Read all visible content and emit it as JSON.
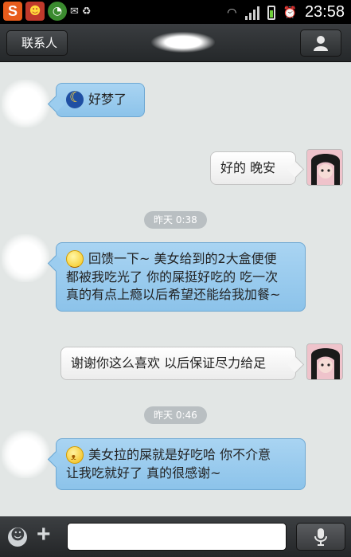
{
  "status_bar": {
    "time": "23:58",
    "app_icons": [
      "weibo-s-icon",
      "face-app-icon",
      "browser-icon",
      "mail-icon",
      "recycle-icon"
    ],
    "s_letter": "S"
  },
  "header": {
    "back_label": "联系人",
    "contact_name_hidden": true,
    "profile_icon": "person-icon"
  },
  "messages": [
    {
      "side": "in",
      "emoji": "moon",
      "text": "好梦了"
    },
    {
      "side": "out",
      "text": "好的  晚安"
    },
    {
      "type": "time",
      "text": "昨天 0:38"
    },
    {
      "side": "in",
      "emoji": "smile",
      "line1": "回馈一下~ 美女给到的2大盒便便",
      "line2": "都被我吃光了 你的屎挺好吃的 吃一次",
      "line3": "真的有点上瘾以后希望还能给我加餐~"
    },
    {
      "side": "out",
      "text": "谢谢你这么喜欢  以后保证尽力给足"
    },
    {
      "type": "time",
      "text": "昨天 0:46"
    },
    {
      "side": "in",
      "emoji": "yawn",
      "line1": "美女拉的屎就是好吃哈 你不介意",
      "line2": "让我吃就好了 真的很感谢~"
    }
  ],
  "input_bar": {
    "placeholder": "",
    "emoji_icon": "emoji-icon",
    "plus_icon": "plus-icon",
    "mic_icon": "microphone-icon"
  }
}
